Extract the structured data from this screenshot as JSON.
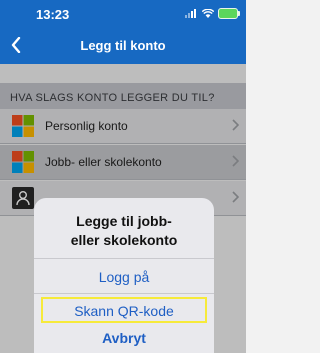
{
  "status_bar": {
    "time": "13:23",
    "icons": [
      "signal-icon",
      "wifi-icon",
      "battery-icon"
    ]
  },
  "nav": {
    "title": "Legg til konto",
    "back_icon": "chevron-left-icon",
    "accent_color": "#1769c2"
  },
  "section": {
    "header": "HVA SLAGS KONTO LEGGER DU TIL?"
  },
  "accounts": [
    {
      "label": "Personlig konto",
      "icon": "microsoft-logo-icon"
    },
    {
      "label": "Jobb- eller skolekonto",
      "icon": "microsoft-logo-icon"
    },
    {
      "label": "",
      "icon": "person-icon"
    }
  ],
  "sheet": {
    "title": "Legge til jobb-\neller skolekonto",
    "actions": {
      "login": "Logg på",
      "scan_qr": "Skann QR-kode",
      "cancel": "Avbryt"
    },
    "highlight_color": "#f6ea3a"
  }
}
